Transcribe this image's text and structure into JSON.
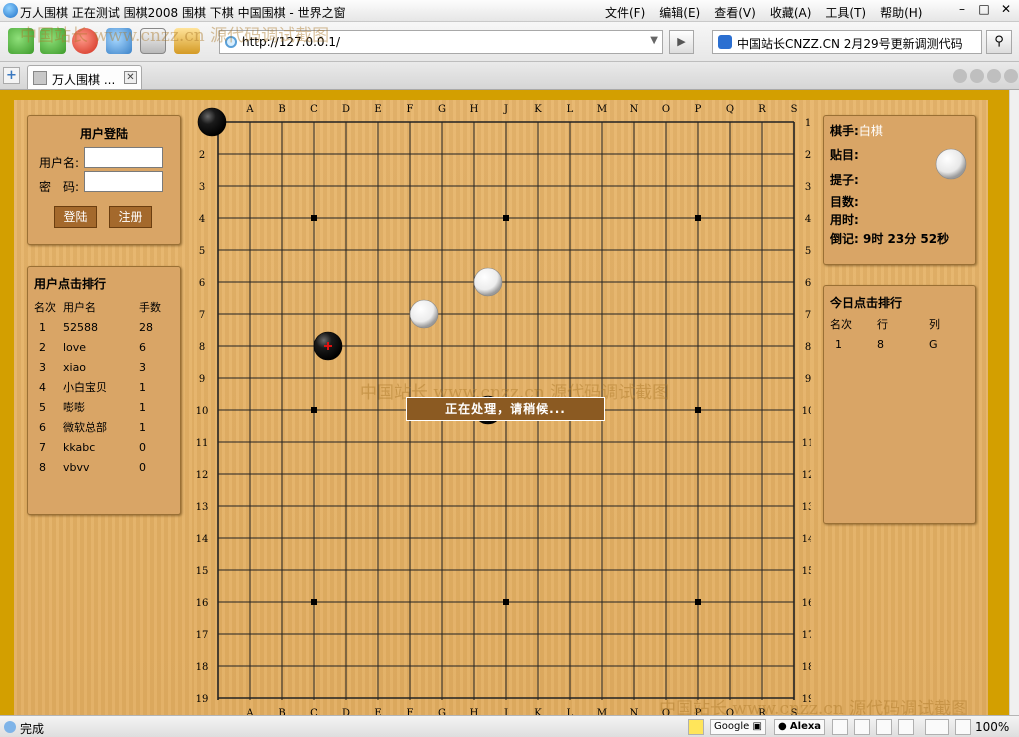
{
  "window": {
    "title": "万人围棋 正在测试 围棋2008 围棋 下棋 中国围棋 - 世界之窗"
  },
  "menu": [
    "文件(F)",
    "编辑(E)",
    "查看(V)",
    "收藏(A)",
    "工具(T)",
    "帮助(H)"
  ],
  "address": {
    "url": "http://127.0.0.1/"
  },
  "search": {
    "text": "中国站长CNZZ.CN 2月29号更新调测代码"
  },
  "tabs": [
    {
      "label": "万人围棋 ..."
    }
  ],
  "login": {
    "title": "用户登陆",
    "username_label": "用户名:",
    "password_label": "密　码:",
    "login_button": "登陆",
    "register_button": "注册"
  },
  "ranking": {
    "title": "用户点击排行",
    "headers": [
      "名次",
      "用户名",
      "手数"
    ],
    "rows": [
      [
        "1",
        "52588",
        "28"
      ],
      [
        "2",
        "love",
        "6"
      ],
      [
        "3",
        "xiao",
        "3"
      ],
      [
        "4",
        "小白宝贝",
        "1"
      ],
      [
        "5",
        "嘭嘭",
        "1"
      ],
      [
        "6",
        "微软总部",
        "1"
      ],
      [
        "7",
        "kkabc",
        "0"
      ],
      [
        "8",
        "vbvv",
        "0"
      ]
    ]
  },
  "game_info": {
    "player_label": "棋手:",
    "player_value": "白棋",
    "komi_label": "贴目:",
    "captured_label": "提子:",
    "count_label": "目数:",
    "time_used_label": "用时:",
    "countdown_label": "倒记:",
    "countdown_value": "9时 23分 52秒"
  },
  "today_ranking": {
    "title": "今日点击排行",
    "headers": [
      "名次",
      "行",
      "列"
    ],
    "rows": [
      [
        "1",
        "8",
        "G"
      ]
    ]
  },
  "board": {
    "columns": [
      "A",
      "B",
      "C",
      "D",
      "E",
      "F",
      "G",
      "H",
      "J",
      "K",
      "L",
      "M",
      "N",
      "O",
      "P",
      "Q",
      "R",
      "S"
    ],
    "rows": [
      "1",
      "2",
      "3",
      "4",
      "5",
      "6",
      "7",
      "8",
      "9",
      "10",
      "11",
      "12",
      "13",
      "14",
      "15",
      "16",
      "17",
      "18",
      "19"
    ],
    "stones": [
      {
        "color": "black",
        "col": 0,
        "row": 1
      },
      {
        "color": "white",
        "col": 9,
        "row": 6
      },
      {
        "color": "white",
        "col": 7,
        "row": 7
      },
      {
        "color": "black",
        "col": 4,
        "row": 8,
        "last_move": true
      },
      {
        "color": "black",
        "col": 9,
        "row": 10
      }
    ],
    "star_points": [
      [
        4,
        4
      ],
      [
        10,
        4
      ],
      [
        16,
        4
      ],
      [
        4,
        10
      ],
      [
        16,
        10
      ],
      [
        4,
        16
      ],
      [
        10,
        16
      ],
      [
        16,
        16
      ]
    ]
  },
  "overlay": {
    "text": "正在处理，请稍候..."
  },
  "watermark": "中国站长 www.cnzz.cn 源代码调试截图",
  "status": {
    "text": "完成",
    "zoom": "100%",
    "google": "Google",
    "alexa": "Alexa"
  }
}
